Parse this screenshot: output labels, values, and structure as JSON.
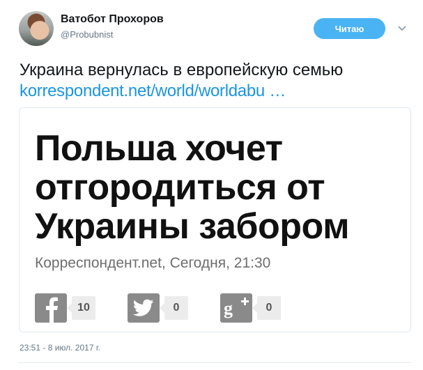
{
  "header": {
    "display_name": "Ватобот Прохоров",
    "handle": "@Probubnist",
    "follow_label": "Читаю"
  },
  "tweet": {
    "text": "Украина вернулась в европейскую семью",
    "link_text": "korrespondent.net/world/worldabu  …",
    "timestamp": "23:51 - 8 июл. 2017 г."
  },
  "card": {
    "headline_lines": [
      "Польша хочет",
      "отгородиться от",
      "Украины забором"
    ],
    "source_line": "Корреспондент.net, Сегодня, 21:30",
    "shares": {
      "facebook": "10",
      "twitter": "0",
      "google_plus": "0"
    }
  },
  "colors": {
    "accent": "#4ab3f4",
    "link": "#1b95e0",
    "share_icon_bg": "#8a8a8a",
    "share_count_bg": "#ececec"
  },
  "icons": {
    "dropdown": "chevron-down-icon",
    "facebook": "facebook-icon",
    "twitter": "twitter-bird-icon",
    "google_plus": "google-plus-icon"
  }
}
